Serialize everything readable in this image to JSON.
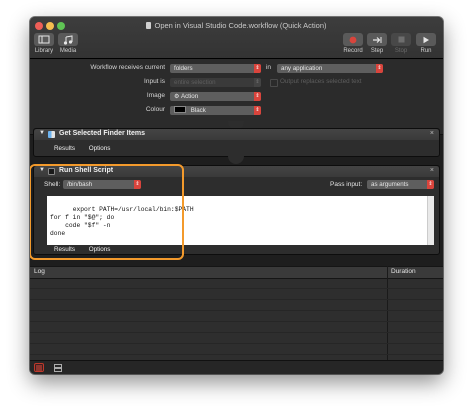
{
  "window": {
    "title": "Open in Visual Studio Code.workflow (Quick Action)"
  },
  "toolbar": {
    "library": "Library",
    "media": "Media",
    "record": "Record",
    "step": "Step",
    "stop": "Stop",
    "run": "Run"
  },
  "workflow": {
    "receives_label": "Workflow receives current",
    "receives_value": "folders",
    "in_label": "in",
    "in_value": "any application",
    "input_is_label": "Input is",
    "input_is_value": "entire selection",
    "replace_label": "Output replaces selected text",
    "image_label": "Image",
    "image_value": "Action",
    "colour_label": "Colour",
    "colour_value": "Black"
  },
  "actions": [
    {
      "title": "Get Selected Finder Items",
      "tabs": [
        "Results",
        "Options"
      ]
    },
    {
      "title": "Run Shell Script",
      "shell_label": "Shell:",
      "shell_value": "/bin/bash",
      "pass_input_label": "Pass input:",
      "pass_input_value": "as arguments",
      "script": "export PATH=/usr/local/bin:$PATH\nfor f in \"$@\"; do\n    code \"$f\" -n\ndone",
      "tabs": [
        "Results",
        "Options"
      ]
    }
  ],
  "log": {
    "col_log": "Log",
    "col_duration": "Duration"
  },
  "colors": {
    "highlight": "#f39a2c",
    "record": "#d9443c",
    "popup_arrow": "#d9443c"
  }
}
